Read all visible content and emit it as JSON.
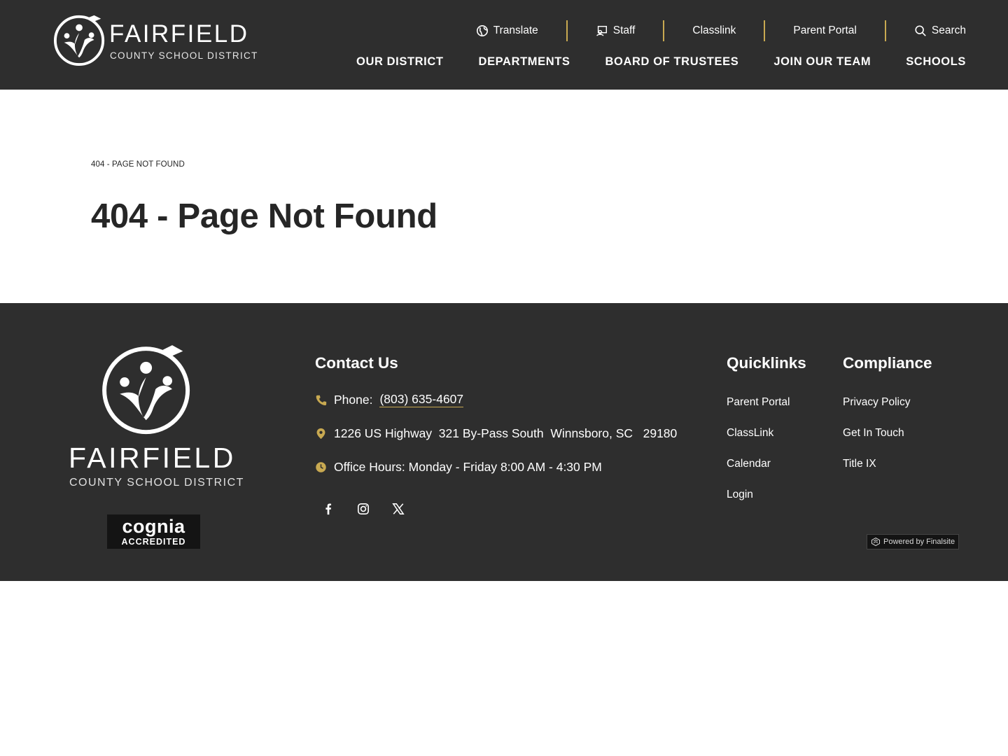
{
  "colors": {
    "header_bg": "#2e2e2e",
    "accent": "#c8a951",
    "text_dark": "#262626"
  },
  "header": {
    "logo": {
      "word": "FAIRFIELD",
      "sub": "COUNTY SCHOOL DISTRICT"
    },
    "utility_nav": [
      {
        "label": "Translate",
        "icon": "globe-icon"
      },
      {
        "label": "Staff",
        "icon": "staff-icon"
      },
      {
        "label": "Classlink",
        "icon": ""
      },
      {
        "label": "Parent Portal",
        "icon": ""
      },
      {
        "label": "Search",
        "icon": "search-icon"
      }
    ],
    "main_nav": [
      "OUR DISTRICT",
      "DEPARTMENTS",
      "BOARD OF TRUSTEES",
      "JOIN OUR TEAM",
      "SCHOOLS"
    ]
  },
  "main": {
    "breadcrumb": "404 - PAGE NOT FOUND",
    "title": "404 - Page Not Found"
  },
  "footer": {
    "logo": {
      "word": "FAIRFIELD",
      "sub": "COUNTY SCHOOL DISTRICT"
    },
    "badge": {
      "top": "cognia",
      "bottom": "ACCREDITED"
    },
    "contact": {
      "heading": "Contact Us",
      "phone_label": "Phone:",
      "phone": "(803) 635-4607",
      "address": "1226 US Highway  321 By-Pass South  Winnsboro, SC   29180",
      "hours": "Office Hours: Monday - Friday 8:00 AM - 4:30 PM",
      "social": [
        "facebook-icon",
        "instagram-icon",
        "x-icon"
      ]
    },
    "quicklinks": {
      "heading": "Quicklinks",
      "items": [
        "Parent Portal",
        "ClassLink",
        "Calendar",
        "Login"
      ]
    },
    "compliance": {
      "heading": "Compliance",
      "items": [
        "Privacy Policy",
        "Get In Touch",
        "Title IX"
      ]
    },
    "powered_by": "Powered by Finalsite"
  }
}
